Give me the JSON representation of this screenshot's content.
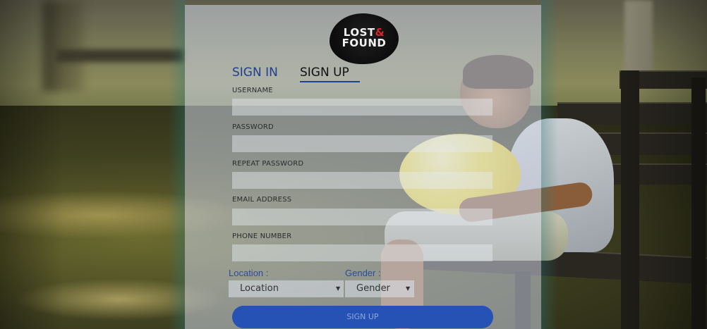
{
  "logo": {
    "line1": "LOST",
    "amp": "&",
    "line2": "FOUND"
  },
  "tabs": {
    "sign_in": "SIGN IN",
    "sign_up": "SIGN UP",
    "active": "sign_up"
  },
  "form": {
    "fields": [
      {
        "label": "USERNAME",
        "value": ""
      },
      {
        "label": "PASSWORD",
        "value": ""
      },
      {
        "label": "REPEAT PASSWORD",
        "value": ""
      },
      {
        "label": "EMAIL ADDRESS",
        "value": ""
      },
      {
        "label": "PHONE NUMBER",
        "value": ""
      }
    ],
    "location": {
      "label": "Location :",
      "selected": "Location"
    },
    "gender": {
      "label": "Gender :",
      "selected": "Gender"
    },
    "submit_label": "SIGN UP"
  },
  "colors": {
    "accent": "#2552b4",
    "tab_active_text": "#1f3f8f",
    "logo_amp": "#d9262b"
  }
}
